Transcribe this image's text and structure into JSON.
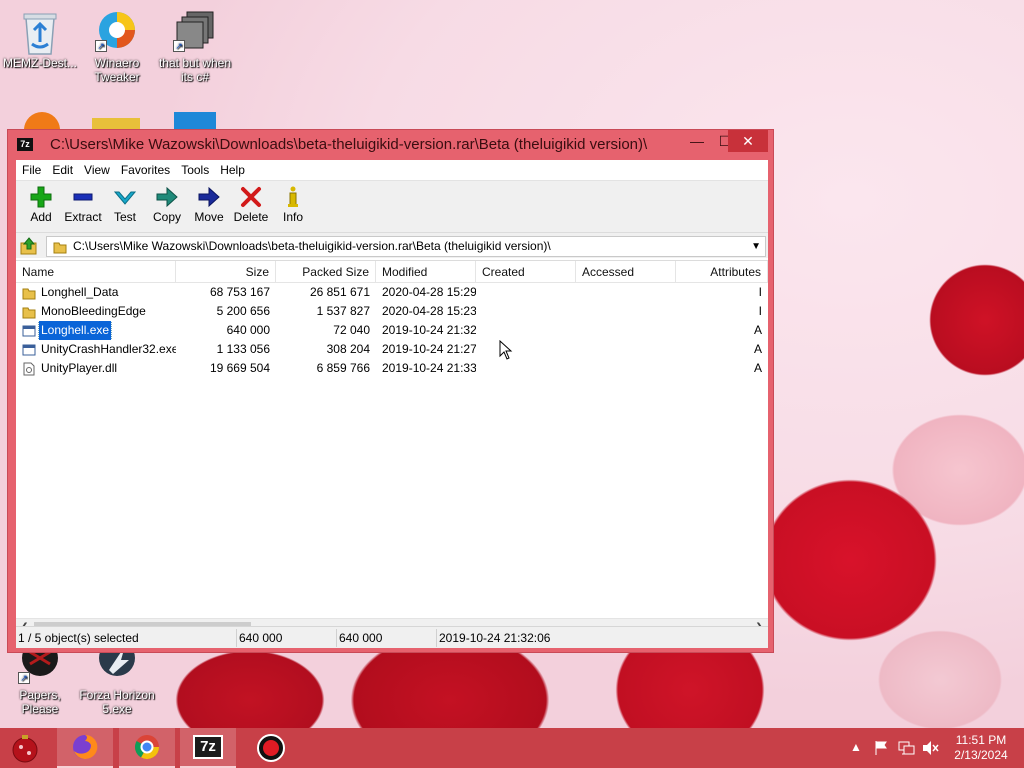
{
  "desktop": {
    "icons": [
      {
        "label": "MEMZ-Dest...",
        "icon": "recycle-bin-icon"
      },
      {
        "label": "Winaero Tweaker",
        "icon": "winaero-icon"
      },
      {
        "label": "that but when its c#",
        "icon": "folder-stack-icon"
      },
      {
        "label": "Papers, Please",
        "icon": "papers-please-icon"
      },
      {
        "label": "Forza Horizon 5.exe",
        "icon": "forza-icon"
      }
    ]
  },
  "window": {
    "title": "C:\\Users\\Mike Wazowski\\Downloads\\beta-theluigikid-version.rar\\Beta (theluigikid version)\\",
    "app_icon_text": "7z",
    "controls": {
      "minimize": "—",
      "maximize": "☐",
      "close": "✕"
    },
    "menu": [
      "File",
      "Edit",
      "View",
      "Favorites",
      "Tools",
      "Help"
    ],
    "toolbar": [
      {
        "label": "Add",
        "icon": "add-icon",
        "color": "#17a617"
      },
      {
        "label": "Extract",
        "icon": "extract-icon",
        "color": "#1a2fb8"
      },
      {
        "label": "Test",
        "icon": "test-icon",
        "color": "#18a7c9"
      },
      {
        "label": "Copy",
        "icon": "copy-icon",
        "color": "#1f8a7a"
      },
      {
        "label": "Move",
        "icon": "move-icon",
        "color": "#1a2a9a"
      },
      {
        "label": "Delete",
        "icon": "delete-icon",
        "color": "#d21a1a"
      },
      {
        "label": "Info",
        "icon": "info-icon",
        "color": "#d8b800"
      }
    ],
    "path": "C:\\Users\\Mike Wazowski\\Downloads\\beta-theluigikid-version.rar\\Beta (theluigikid version)\\",
    "columns": [
      "Name",
      "Size",
      "Packed Size",
      "Modified",
      "Created",
      "Accessed",
      "Attributes"
    ],
    "rows": [
      {
        "name": "Longhell_Data",
        "size": "68 753 167",
        "packed": "26 851 671",
        "modified": "2020-04-28 15:29",
        "created": "",
        "accessed": "",
        "attr": "I",
        "type": "folder",
        "selected": false
      },
      {
        "name": "MonoBleedingEdge",
        "size": "5 200 656",
        "packed": "1 537 827",
        "modified": "2020-04-28 15:23",
        "created": "",
        "accessed": "",
        "attr": "I",
        "type": "folder",
        "selected": false
      },
      {
        "name": "Longhell.exe",
        "size": "640 000",
        "packed": "72 040",
        "modified": "2019-10-24 21:32",
        "created": "",
        "accessed": "",
        "attr": "A",
        "type": "exe",
        "selected": true
      },
      {
        "name": "UnityCrashHandler32.exe",
        "size": "1 133 056",
        "packed": "308 204",
        "modified": "2019-10-24 21:27",
        "created": "",
        "accessed": "",
        "attr": "A",
        "type": "exe",
        "selected": false
      },
      {
        "name": "UnityPlayer.dll",
        "size": "19 669 504",
        "packed": "6 859 766",
        "modified": "2019-10-24 21:33",
        "created": "",
        "accessed": "",
        "attr": "A",
        "type": "dll",
        "selected": false
      }
    ],
    "status": {
      "selection": "1 / 5 object(s) selected",
      "size": "640 000",
      "packed": "640 000",
      "modified": "2019-10-24 21:32:06"
    }
  },
  "taskbar": {
    "apps": [
      {
        "name": "start-button",
        "icon": "start-ornament-icon"
      },
      {
        "name": "firefox",
        "icon": "firefox-icon"
      },
      {
        "name": "chrome",
        "icon": "chrome-icon"
      },
      {
        "name": "7-zip",
        "icon": "sevenzip-icon",
        "text": "7z"
      },
      {
        "name": "recorder",
        "icon": "record-icon"
      }
    ],
    "clock_time": "11:51 PM",
    "clock_date": "2/13/2024"
  }
}
